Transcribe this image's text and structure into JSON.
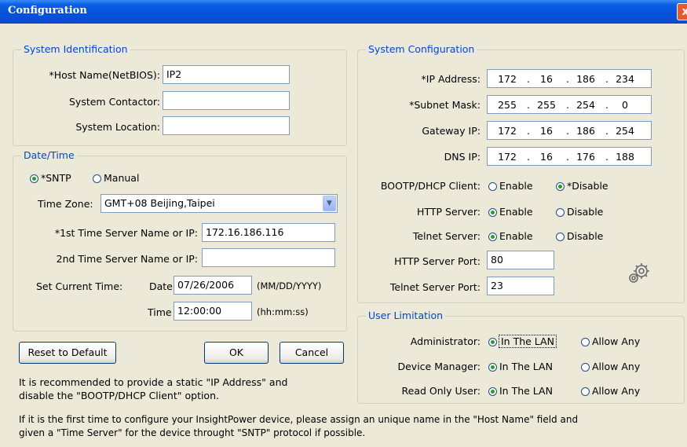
{
  "window": {
    "title": "Configuration",
    "close_label": "x"
  },
  "sysid": {
    "legend": "System Identification",
    "host_label": "*Host Name(NetBIOS):",
    "host_value": "IP2",
    "contactor_label": "System Contactor:",
    "contactor_value": "",
    "location_label": "System Location:",
    "location_value": ""
  },
  "datetime": {
    "legend": "Date/Time",
    "sntp_label": "*SNTP",
    "manual_label": "Manual",
    "mode_selected": "SNTP",
    "tz_label": "Time Zone:",
    "tz_value": "GMT+08 Beijing,Taipei",
    "ts1_label": "*1st Time Server Name or IP:",
    "ts1_value": "172.16.186.116",
    "ts2_label": "2nd Time Server Name or IP:",
    "ts2_value": "",
    "set_time_label": "Set Current Time:",
    "date_label": "Date",
    "date_value": "07/26/2006",
    "date_fmt": "(MM/DD/YYYY)",
    "time_label": "Time",
    "time_value": "12:00:00",
    "time_fmt": "(hh:mm:ss)"
  },
  "buttons": {
    "reset": "Reset to Default",
    "ok": "OK",
    "cancel": "Cancel"
  },
  "note_left": {
    "line1": "It is recommended to provide a static \"IP Address\" and",
    "line2": "disable the \"BOOTP/DHCP Client\" option."
  },
  "syscfg": {
    "legend": "System Configuration",
    "ip_label": "*IP Address:",
    "ip": [
      "172",
      "16",
      "186",
      "234"
    ],
    "mask_label": "*Subnet Mask:",
    "mask": [
      "255",
      "255",
      "254",
      "0"
    ],
    "gw_label": "Gateway IP:",
    "gw": [
      "172",
      "16",
      "186",
      "254"
    ],
    "dns_label": "DNS IP:",
    "dns": [
      "172",
      "16",
      "176",
      "188"
    ],
    "bootp_label": "BOOTP/DHCP Client:",
    "bootp_enable": "Enable",
    "bootp_disable": "*Disable",
    "bootp_selected": "Disable",
    "http_label": "HTTP Server:",
    "http_enable": "Enable",
    "http_disable": "Disable",
    "http_selected": "Enable",
    "telnet_label": "Telnet Server:",
    "telnet_enable": "Enable",
    "telnet_disable": "Disable",
    "telnet_selected": "Enable",
    "http_port_label": "HTTP Server Port:",
    "http_port": "80",
    "telnet_port_label": "Telnet Server Port:",
    "telnet_port": "23"
  },
  "userlim": {
    "legend": "User Limitation",
    "admin_label": "Administrator:",
    "devmgr_label": "Device Manager:",
    "readonly_label": "Read Only User:",
    "lan_label": "In The LAN",
    "any_label": "Allow Any",
    "admin_selected": "In The LAN",
    "devmgr_selected": "In The LAN",
    "readonly_selected": "In The LAN"
  },
  "bottom_note": {
    "line1": "If it is the first time to configure your InsightPower device, please assign an unique name in the \"Host Name\" field and",
    "line2": "given a \"Time Server\" for the device throught \"SNTP\" protocol if possible."
  },
  "icons": {
    "gear": "gear-icon",
    "dropdown": "chevron-down-icon",
    "close": "close-icon"
  },
  "colors": {
    "title_bar": "#0550DA",
    "legend_text": "#0046D5",
    "close_button": "#E45A2E",
    "window_bg": "#ECE9D8"
  }
}
